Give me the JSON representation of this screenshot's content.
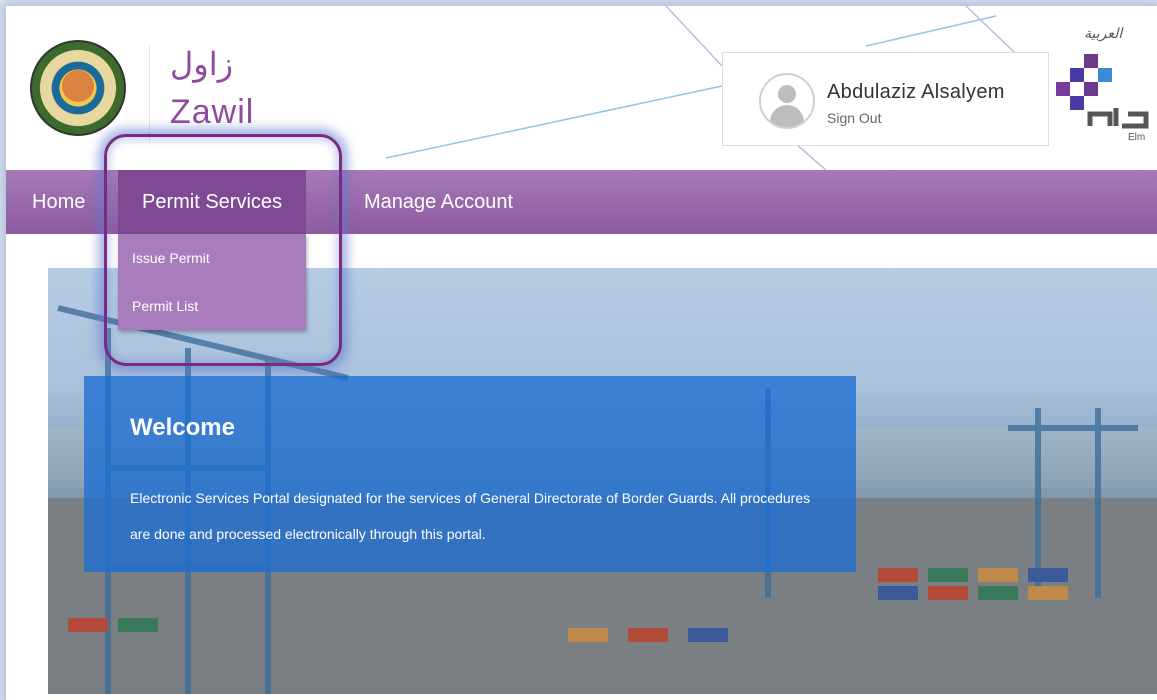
{
  "header": {
    "brand_arabic": "زاول",
    "brand_english": "Zawil",
    "language_link": "العربية",
    "partner_logo_label": "Elm"
  },
  "user": {
    "name": "Abdulaziz Alsalyem",
    "sign_out_label": "Sign Out"
  },
  "nav": {
    "items": [
      {
        "label": "Home"
      },
      {
        "label": "Permit Services",
        "active": true
      },
      {
        "label": "Manage Account"
      }
    ],
    "dropdown": [
      {
        "label": "Issue Permit"
      },
      {
        "label": "Permit List"
      }
    ]
  },
  "hero": {
    "title": "Welcome",
    "text": "Electronic Services Portal designated for the services of General Directorate of Border Guards. All procedures are done and processed electronically through this portal."
  },
  "colors": {
    "brand_purple": "#8e4c9c",
    "nav_purple": "#9a6aac",
    "welcome_blue": "#1e6ed2",
    "highlight_ring": "#7b2b7f"
  }
}
